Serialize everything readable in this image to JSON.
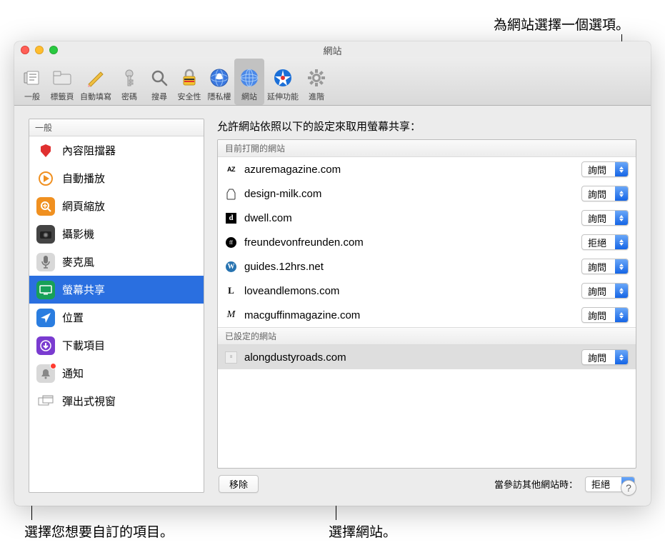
{
  "callouts": {
    "top": "為網站選擇一個選項。",
    "bottom_left": "選擇您想要自訂的項目。",
    "bottom_right": "選擇網站。"
  },
  "window": {
    "title": "網站"
  },
  "toolbar": {
    "items": [
      {
        "label": "一般",
        "icon": "general"
      },
      {
        "label": "標籤頁",
        "icon": "tabs"
      },
      {
        "label": "自動填寫",
        "icon": "autofill"
      },
      {
        "label": "密碼",
        "icon": "passwords"
      },
      {
        "label": "搜尋",
        "icon": "search"
      },
      {
        "label": "安全性",
        "icon": "security"
      },
      {
        "label": "隱私權",
        "icon": "privacy"
      },
      {
        "label": "網站",
        "icon": "websites",
        "selected": true
      },
      {
        "label": "延伸功能",
        "icon": "extensions"
      },
      {
        "label": "進階",
        "icon": "advanced"
      }
    ]
  },
  "sidebar": {
    "header": "一般",
    "items": [
      {
        "label": "內容阻擋器",
        "icon": "content-blocker"
      },
      {
        "label": "自動播放",
        "icon": "autoplay"
      },
      {
        "label": "網頁縮放",
        "icon": "page-zoom"
      },
      {
        "label": "攝影機",
        "icon": "camera"
      },
      {
        "label": "麥克風",
        "icon": "microphone"
      },
      {
        "label": "螢幕共享",
        "icon": "screen-share",
        "selected": true
      },
      {
        "label": "位置",
        "icon": "location"
      },
      {
        "label": "下載項目",
        "icon": "downloads"
      },
      {
        "label": "通知",
        "icon": "notifications",
        "badge": true
      },
      {
        "label": "彈出式視窗",
        "icon": "popup-windows"
      }
    ]
  },
  "main": {
    "title": "允許網站依照以下的設定來取用螢幕共享：",
    "section_open": "目前打開的網站",
    "section_configured": "已設定的網站",
    "open_sites": [
      {
        "domain": "azuremagazine.com",
        "fav": "AZ",
        "option": "詢問"
      },
      {
        "domain": "design-milk.com",
        "fav": "milk",
        "option": "詢問"
      },
      {
        "domain": "dwell.com",
        "fav": "d",
        "option": "詢問"
      },
      {
        "domain": "freundevonfreunden.com",
        "fav": "fvf",
        "option": "拒絕"
      },
      {
        "domain": "guides.12hrs.net",
        "fav": "wp",
        "option": "詢問"
      },
      {
        "domain": "loveandlemons.com",
        "fav": "L",
        "option": "詢問"
      },
      {
        "domain": "macguffinmagazine.com",
        "fav": "M",
        "option": "詢問"
      }
    ],
    "configured_sites": [
      {
        "domain": "alongdustyroads.com",
        "fav": "adr",
        "option": "詢問",
        "selected": true
      }
    ],
    "remove_btn": "移除",
    "other_sites_label": "當參訪其他網站時：",
    "other_sites_option": "拒絕"
  }
}
